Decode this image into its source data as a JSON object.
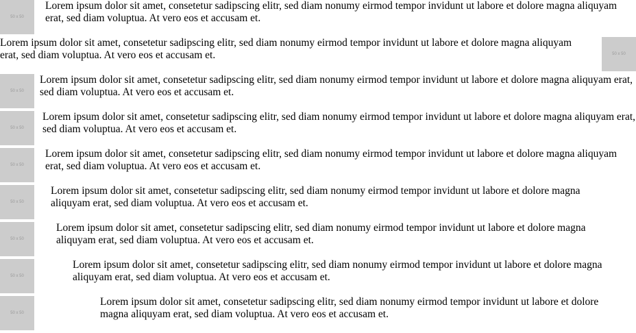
{
  "placeholder_label": "50 x 50",
  "paragraph_text": "Lorem ipsum dolor sit amet, consetetur sadipscing elitr, sed diam nonumy eirmod tempor invidunt ut labore et dolore magna aliquyam erat, sed diam voluptua. At vero eos et accusam et.",
  "rows": [
    {
      "media_side": "left"
    },
    {
      "media_side": "right"
    },
    {
      "media_side": "left"
    },
    {
      "media_side": "left"
    },
    {
      "media_side": "left"
    },
    {
      "media_side": "left"
    },
    {
      "media_side": "left"
    },
    {
      "media_side": "left"
    },
    {
      "media_side": "left"
    }
  ]
}
